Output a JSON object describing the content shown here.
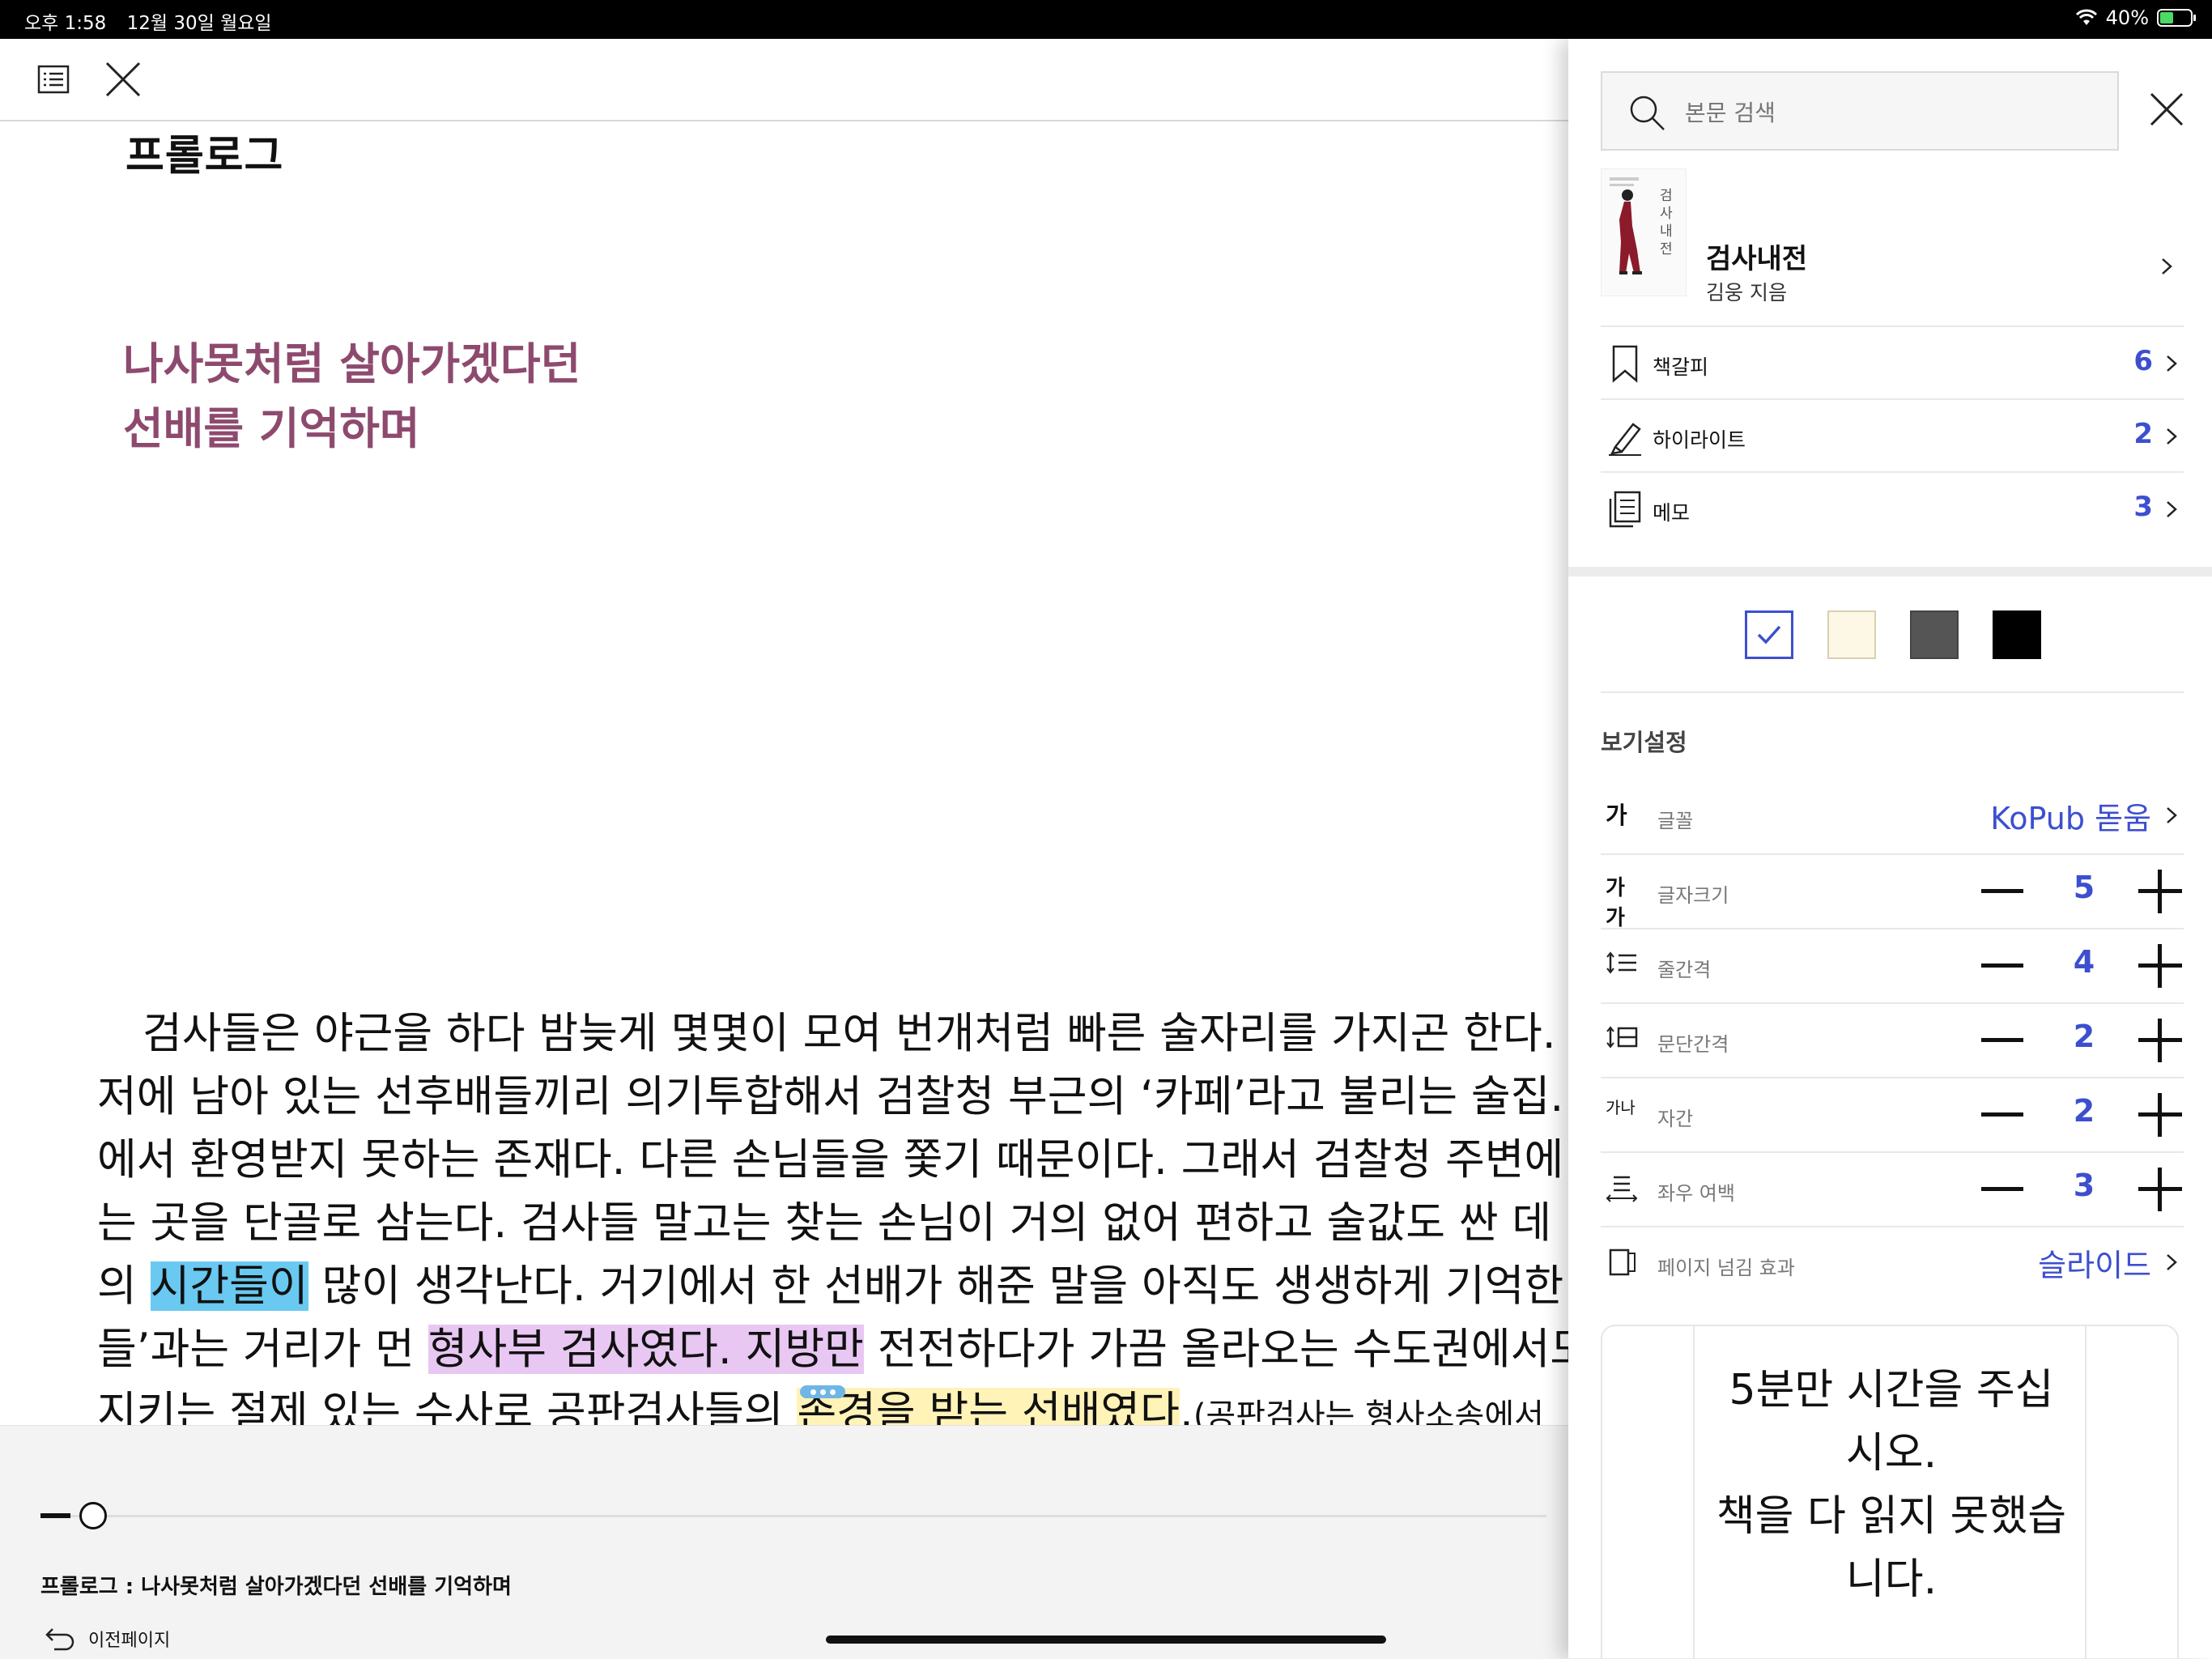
{
  "status_bar": {
    "time": "오후 1:58",
    "date": "12월 30일 월요일",
    "battery": "40%"
  },
  "reader": {
    "page_title": "프롤로그",
    "dedication": [
      "나사못처럼 살아가겠다던",
      "선배를 기억하며"
    ],
    "body": {
      "l1": "검사들은 야근을 하다 밤늦게 몇몇이 모여 번개처럼 빠른 술자리를 가지곤 한다.",
      "l2": "저에 남아 있는 선후배들끼리 의기투합해서 검찰청 부근의 ‘카페’라고 불리는 술집.",
      "l3": "에서 환영받지 못하는 존재다. 다른 손님들을 쫓기 때문이다. 그래서 검찰청 주변에",
      "l4": "는 곳을 단골로 삼는다. 검사들 말고는 찾는 손님이 거의 없어 편하고 술값도 싼 데",
      "l5a": "의 ",
      "l5hl": "시간들이",
      "l5b": " 많이 생각난다. 거기에서 한 선배가 해준 말을 아직도 생생하게 기억한",
      "l6a": "들’과는 거리가 먼 ",
      "l6hl": "형사부 검사였다. 지방만",
      "l6b": " 전전하다가 가끔 올라오는 수도권에서도",
      "l7a": "지키는 절제 있는 수사로 공판검사들의 ",
      "l7hl": "존경을 받는 선배였다",
      "l7b": ".",
      "l7small": "(공판검사는 형사소송에서"
    },
    "chapter_info": "프롤로그 : 나사못처럼 살아가겠다던 선배를 기억하며",
    "prev_page": "이전페이지",
    "progress": 0.02
  },
  "panel": {
    "search_placeholder": "본문 검색",
    "book": {
      "title": "검사내전",
      "author": "김웅 지음",
      "cover_text": "검사내전"
    },
    "lists": [
      {
        "label": "책갈피",
        "count": "6"
      },
      {
        "label": "하이라이트",
        "count": "2"
      },
      {
        "label": "메모",
        "count": "3"
      }
    ],
    "themes": [
      "white",
      "cream",
      "gray",
      "black"
    ],
    "selected_theme": "white",
    "view_settings_title": "보기설정",
    "font": {
      "icon": "가",
      "label": "글꼴",
      "value": "KoPub 돋움"
    },
    "settings": [
      {
        "icon": "가가",
        "label": "글자크기",
        "value": "5"
      },
      {
        "icon": "line-spacing-icon",
        "label": "줄간격",
        "value": "4"
      },
      {
        "icon": "paragraph-spacing-icon",
        "label": "문단간격",
        "value": "2"
      },
      {
        "icon": "가나",
        "label": "자간",
        "value": "2"
      },
      {
        "icon": "margin-icon",
        "label": "좌우 여백",
        "value": "3"
      }
    ],
    "page_effect": {
      "label": "페이지 넘김 효과",
      "value": "슬라이드"
    },
    "preview_text": [
      "5분만 시간을 주십",
      "시오.",
      "책을 다 읽지 못했습",
      "니다."
    ]
  },
  "colors": {
    "accent": "#3d4fcf",
    "dedication": "#8e4a6e",
    "highlight_blue": "#69c9f1",
    "highlight_purple": "#e8c7f3",
    "highlight_yellow": "#fff3b8"
  }
}
